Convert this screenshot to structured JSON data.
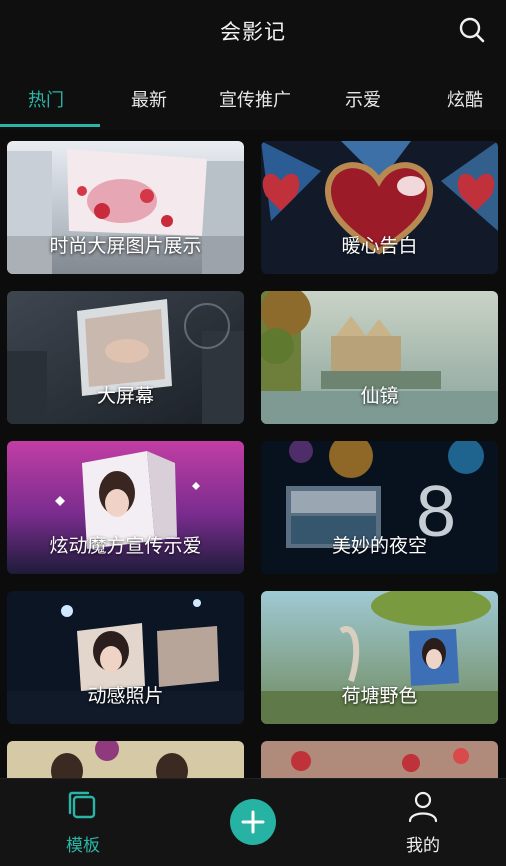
{
  "header": {
    "title": "会影记",
    "search_icon": "search-icon"
  },
  "tabs": [
    {
      "label": "热门",
      "active": true
    },
    {
      "label": "最新",
      "active": false
    },
    {
      "label": "宣传推广",
      "active": false
    },
    {
      "label": "示爱",
      "active": false
    },
    {
      "label": "炫酷",
      "active": false
    }
  ],
  "templates": [
    {
      "title": "时尚大屏图片展示"
    },
    {
      "title": "暖心告白"
    },
    {
      "title": "大屏幕"
    },
    {
      "title": "仙镜"
    },
    {
      "title": "炫动魔方宣传示爱"
    },
    {
      "title": "美妙的夜空"
    },
    {
      "title": "动感照片"
    },
    {
      "title": "荷塘野色"
    },
    {
      "title": ""
    },
    {
      "title": ""
    }
  ],
  "bottom_nav": {
    "templates_label": "模板",
    "me_label": "我的",
    "add_icon": "plus-icon"
  },
  "colors": {
    "accent": "#29b6a8",
    "background": "#0c0c0c"
  }
}
